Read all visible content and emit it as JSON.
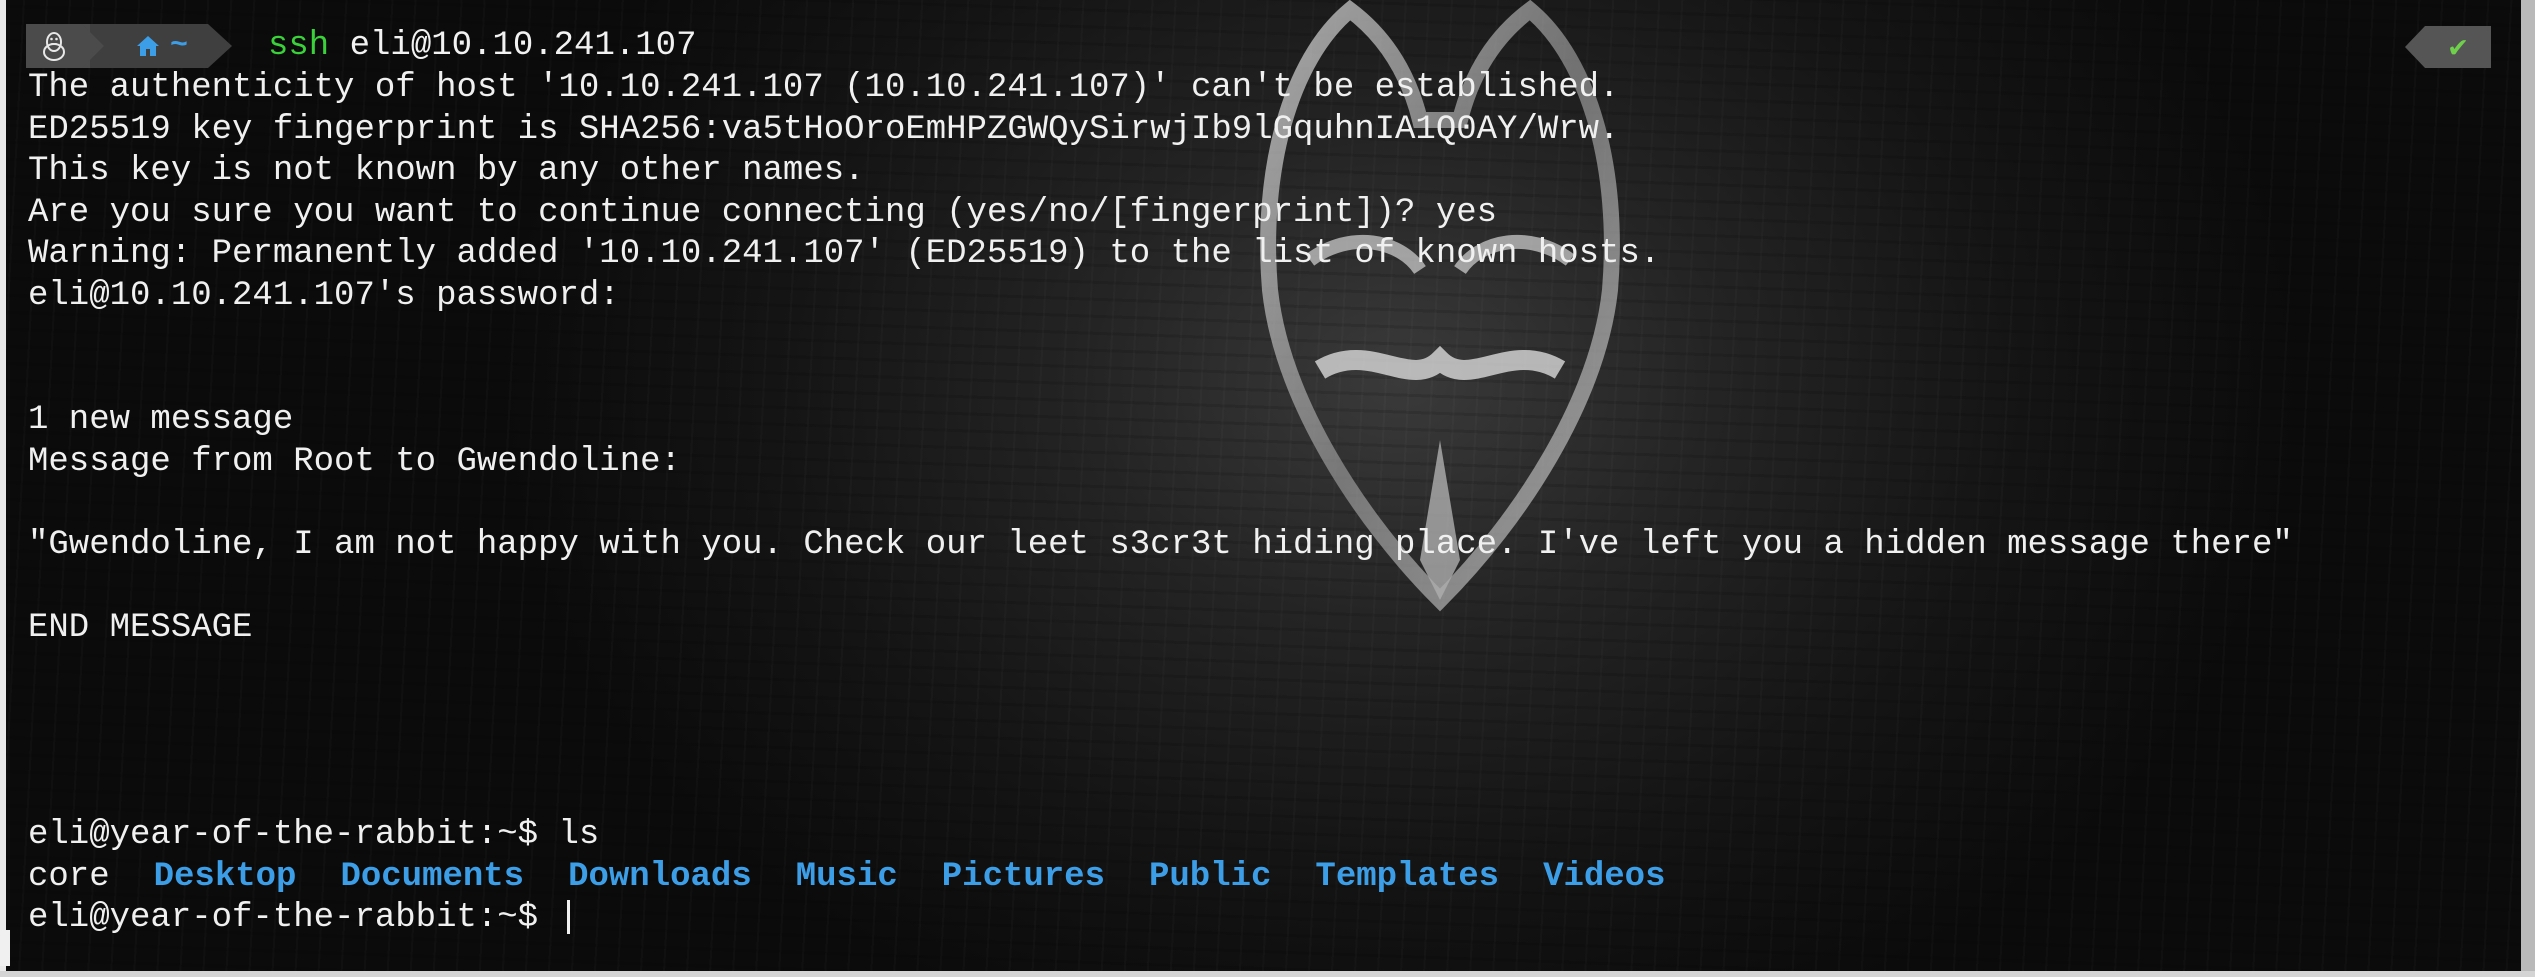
{
  "prompt": {
    "os_icon": "linux-penguin-icon",
    "home_icon": "home-icon",
    "dir": "~",
    "command_word": "ssh",
    "command_arg": "eli@10.10.241.107",
    "status_icon": "check-icon",
    "status_symbol": "✔"
  },
  "output": [
    "The authenticity of host '10.10.241.107 (10.10.241.107)' can't be established.",
    "ED25519 key fingerprint is SHA256:va5tHoOroEmHPZGWQySirwjIb9lGquhnIA1Q0AY/Wrw.",
    "This key is not known by any other names.",
    "Are you sure you want to continue connecting (yes/no/[fingerprint])? yes",
    "Warning: Permanently added '10.10.241.107' (ED25519) to the list of known hosts.",
    "eli@10.10.241.107's password:",
    "",
    "",
    "1 new message",
    "Message from Root to Gwendoline:",
    "",
    "\"Gwendoline, I am not happy with you. Check our leet s3cr3t hiding place. I've left you a hidden message there\"",
    "",
    "END MESSAGE",
    "",
    "",
    "",
    "",
    "eli@year-of-the-rabbit:~$ ls"
  ],
  "ls_output": {
    "file": "core",
    "dirs": [
      "Desktop",
      "Documents",
      "Downloads",
      "Music",
      "Pictures",
      "Public",
      "Templates",
      "Videos"
    ]
  },
  "final_prompt": "eli@year-of-the-rabbit:~$ ",
  "colors": {
    "command": "#3ad13a",
    "directory": "#3d9ee8",
    "text": "#f0f0f0",
    "status_ok": "#6fd04b"
  }
}
